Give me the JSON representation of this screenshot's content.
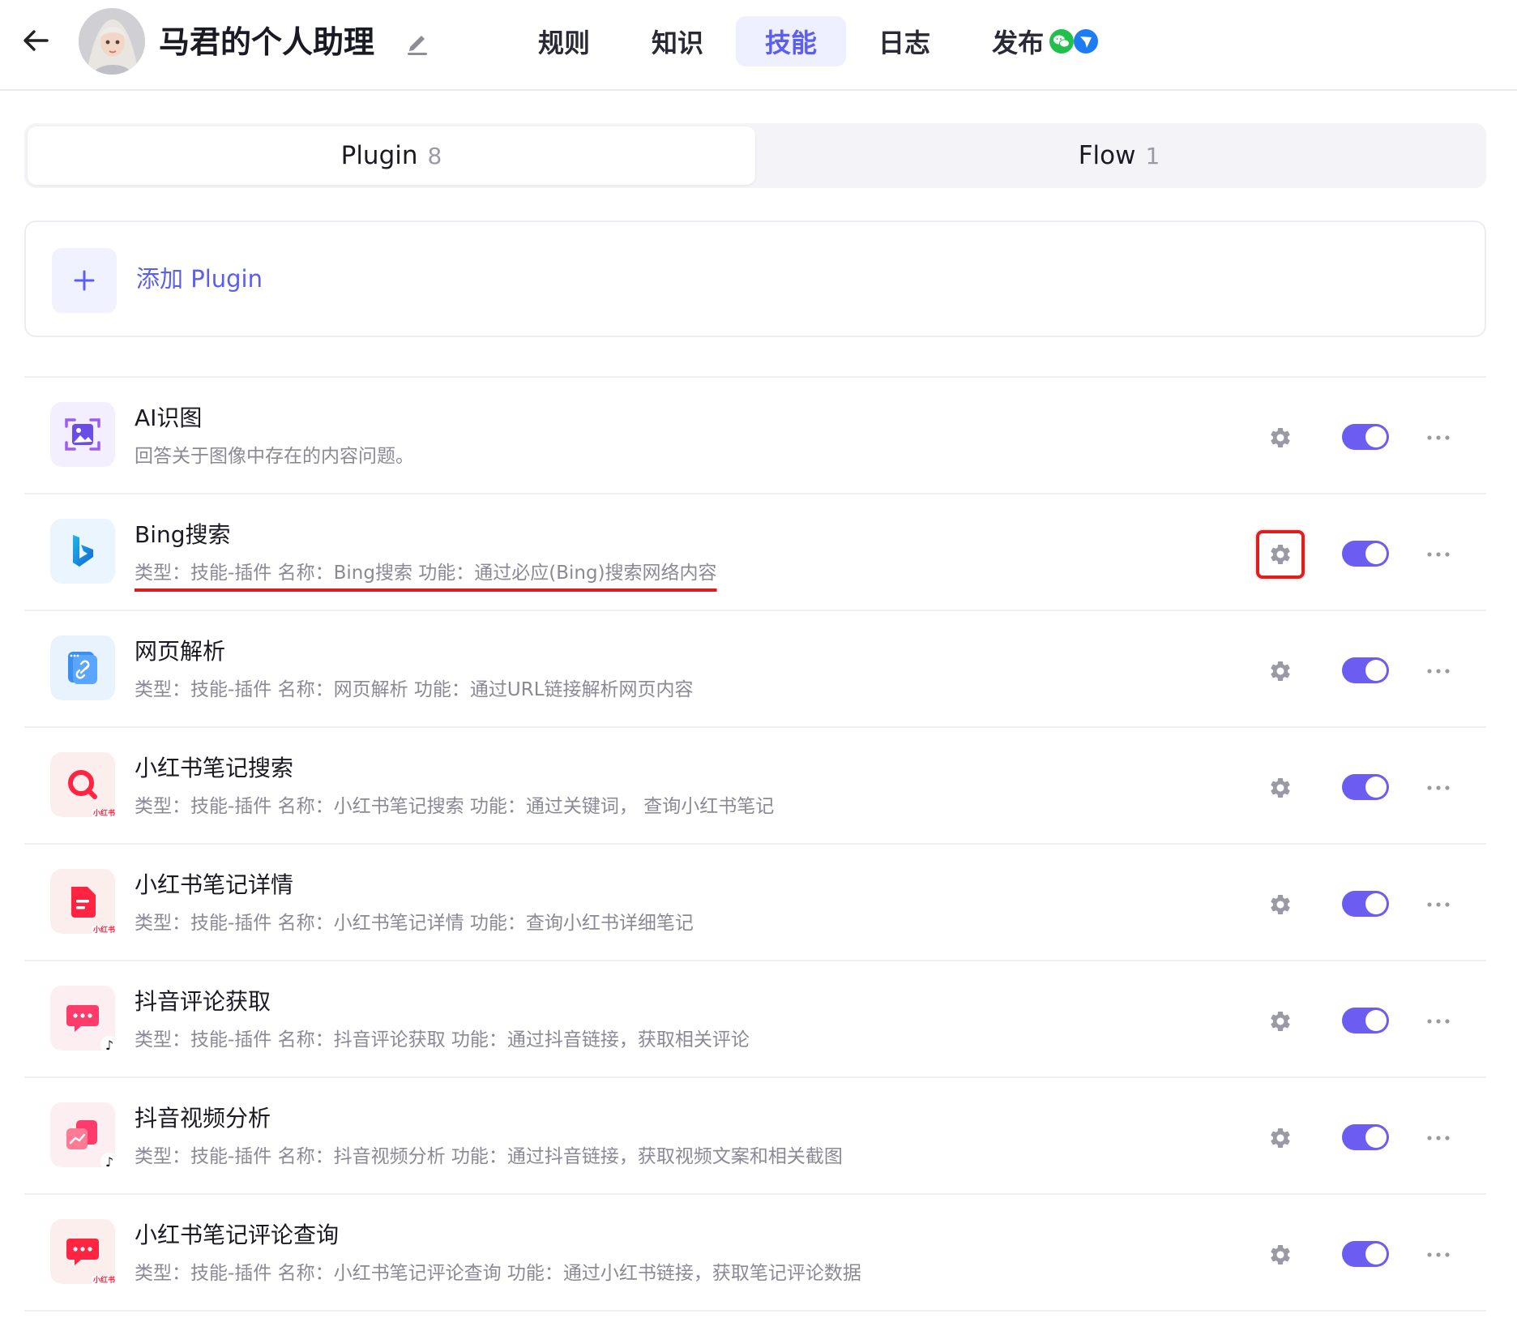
{
  "header": {
    "title": "马君的个人助理",
    "tabs": [
      {
        "label": "规则",
        "active": false
      },
      {
        "label": "知识",
        "active": false
      },
      {
        "label": "技能",
        "active": true
      },
      {
        "label": "日志",
        "active": false
      },
      {
        "label": "发布",
        "active": false
      }
    ],
    "icons": {
      "back": "arrow-left-icon",
      "edit": "pencil-icon",
      "publish": [
        "wechat-icon",
        "feishu-icon"
      ]
    }
  },
  "segment": {
    "tabs": [
      {
        "label": "Plugin",
        "count": "8",
        "active": true
      },
      {
        "label": "Flow",
        "count": "1",
        "active": false
      }
    ]
  },
  "add_plugin": {
    "label": "添加 Plugin"
  },
  "plugins": [
    {
      "name": "AI识图",
      "desc": "回答关于图像中存在的内容问题。",
      "enabled": true,
      "icon": "image-recognition-icon"
    },
    {
      "name": "Bing搜索",
      "desc": "类型：技能-插件 名称：Bing搜索 功能：通过必应(Bing)搜索网络内容",
      "enabled": true,
      "icon": "bing-icon"
    },
    {
      "name": "网页解析",
      "desc": "类型：技能-插件 名称：网页解析 功能：通过URL链接解析网页内容",
      "enabled": true,
      "icon": "link-document-icon"
    },
    {
      "name": "小红书笔记搜索",
      "desc": "类型：技能-插件 名称：小红书笔记搜索 功能：通过关键词， 查询小红书笔记",
      "enabled": true,
      "icon": "xiaohongshu-search-icon"
    },
    {
      "name": "小红书笔记详情",
      "desc": "类型：技能-插件 名称：小红书笔记详情 功能：查询小红书详细笔记",
      "enabled": true,
      "icon": "xiaohongshu-note-icon"
    },
    {
      "name": "抖音评论获取",
      "desc": "类型：技能-插件 名称：抖音评论获取 功能：通过抖音链接，获取相关评论",
      "enabled": true,
      "icon": "douyin-comment-icon"
    },
    {
      "name": "抖音视频分析",
      "desc": "类型：技能-插件 名称：抖音视频分析 功能：通过抖音链接，获取视频文案和相关截图",
      "enabled": true,
      "icon": "douyin-video-icon"
    },
    {
      "name": "小红书笔记评论查询",
      "desc": "类型：技能-插件 名称：小红书笔记评论查询 功能：通过小红书链接，获取笔记评论数据",
      "enabled": true,
      "icon": "xiaohongshu-comment-icon"
    }
  ],
  "colors": {
    "accent": "#6b5cf2",
    "accent_text": "#5b5ef0",
    "highlight": "#e01e1e"
  }
}
